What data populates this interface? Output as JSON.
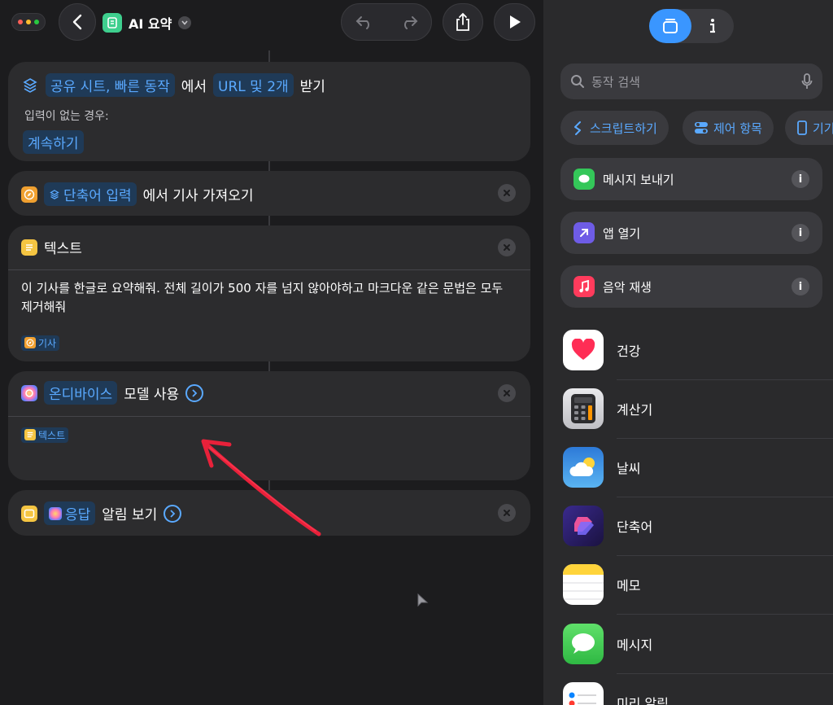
{
  "header": {
    "title": "AI 요약"
  },
  "cards": {
    "receive": {
      "source_token": "공유 시트, 빠른 동작",
      "from_text": "에서",
      "type_token": "URL 및 2개",
      "action_text": "받기",
      "no_input_label": "입력이 없는 경우:",
      "continue_token": "계속하기"
    },
    "article": {
      "input_token": "단축어 입력",
      "action_text": "에서 기사 가져오기"
    },
    "text": {
      "title": "텍스트",
      "body": "이 기사를 한글로 요약해줘. 전체 길이가 500 자를 넘지 않아야하고 마크다운 같은 문법은 모두 제거해줘",
      "variable_token": "기사"
    },
    "model": {
      "model_token": "온디바이스",
      "action_text": "모델 사용",
      "input_token": "텍스트"
    },
    "alert": {
      "response_token": "응답",
      "action_text": "알림 보기"
    }
  },
  "sidebar": {
    "search_placeholder": "동작 검색",
    "chips": [
      "스크립트하기",
      "제어 항목",
      "기기"
    ],
    "suggestions": [
      {
        "label": "메시지 보내기",
        "icon": "messages-icon"
      },
      {
        "label": "앱 열기",
        "icon": "open-app-icon"
      },
      {
        "label": "음악 재생",
        "icon": "music-icon"
      }
    ],
    "apps": [
      {
        "label": "건강",
        "icon": "health-icon"
      },
      {
        "label": "계산기",
        "icon": "calculator-icon"
      },
      {
        "label": "날씨",
        "icon": "weather-icon"
      },
      {
        "label": "단축어",
        "icon": "shortcuts-icon"
      },
      {
        "label": "메모",
        "icon": "notes-icon"
      },
      {
        "label": "메시지",
        "icon": "messages-icon"
      },
      {
        "label": "미리 알림",
        "icon": "reminders-icon"
      }
    ]
  },
  "colors": {
    "accent": "#3a96ff",
    "token_text": "#5aa9ff",
    "annotation_arrow": "#e8213a"
  }
}
